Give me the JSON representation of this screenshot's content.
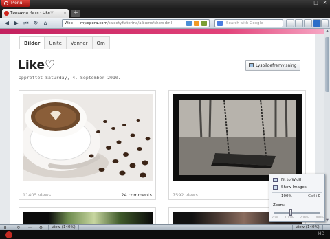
{
  "browser": {
    "menu_label": "Menu",
    "tab_title": "Тришина Катя - Like♡",
    "new_tab": "+",
    "address_prefix": "Web",
    "url_host": "my.opera.com",
    "url_path": "/sweetyKaterina/albums/show.dml",
    "search_placeholder": "Search with Google",
    "window_buttons": [
      "–",
      "□",
      "✕"
    ]
  },
  "page": {
    "tabs": [
      {
        "label": "Bilder",
        "active": true
      },
      {
        "label": "Unite",
        "active": false
      },
      {
        "label": "Venner",
        "active": false
      },
      {
        "label": "Om",
        "active": false
      }
    ],
    "album_title": "Like♡",
    "created": "Opprettet Saturday, 4. September 2010.",
    "slideshow_button": "Lysbildefremvisning",
    "photos": [
      {
        "name": "coffee-photo",
        "views": "11405 views",
        "comments": "24 comments"
      },
      {
        "name": "swing-photo",
        "views": "7592 views",
        "comments": ""
      }
    ]
  },
  "popup": {
    "fit_to_width": "Fit to Width",
    "show_images": "Show Images",
    "zoom_value": "100%",
    "zoom_shortcut": "Ctrl+0",
    "zoom_label": "Zoom:",
    "zoom_ticks": [
      "20%",
      "100%",
      "200%",
      "300%"
    ]
  },
  "statusbar": {
    "view_left": "View (140%)",
    "view_right": "View (140%)"
  },
  "colors": {
    "brand_red": "#d0241c",
    "pink_accent": "#e2437a"
  }
}
